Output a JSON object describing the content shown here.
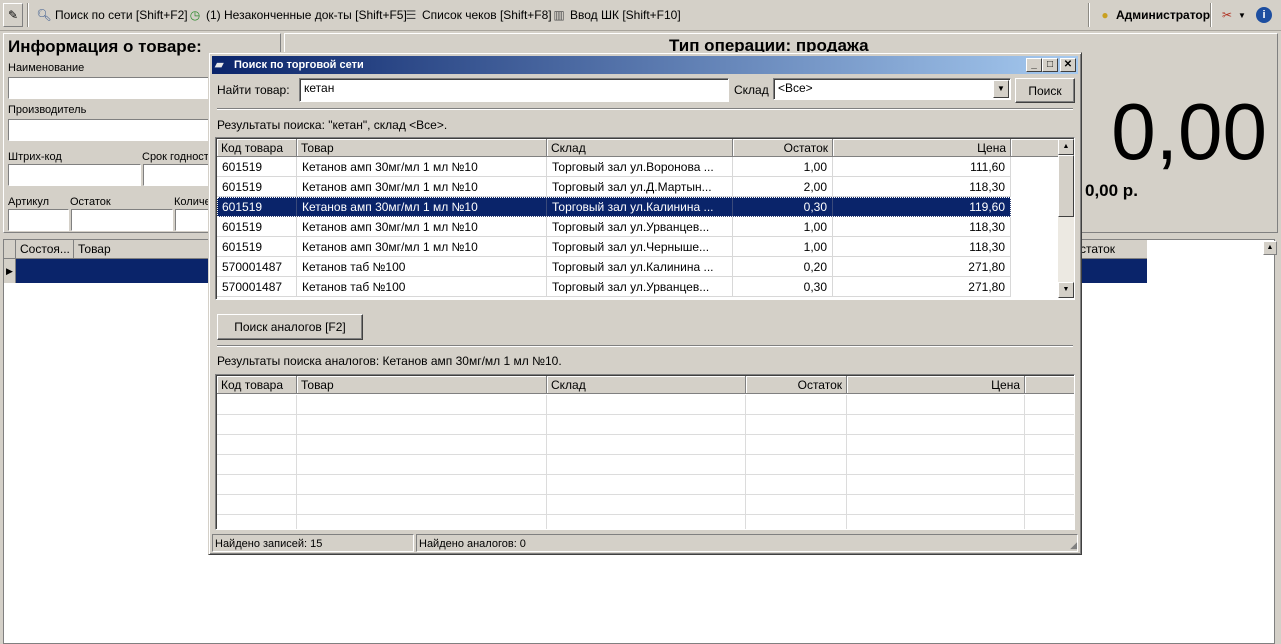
{
  "toolbar": {
    "items": [
      {
        "label": "Поиск по сети [Shift+F2]",
        "icon": "magnifier-icon"
      },
      {
        "label": "(1) Незаконченные док-ты [Shift+F5]",
        "icon": "clock-icon"
      },
      {
        "label": "Список чеков [Shift+F8]",
        "icon": "list-icon"
      },
      {
        "label": "Ввод ШК [Shift+F10]",
        "icon": "barcode-icon"
      }
    ],
    "user": "Администратор"
  },
  "product_info": {
    "heading": "Информация о товаре:",
    "name_label": "Наименование",
    "manufacturer_label": "Производитель",
    "barcode_label": "Штрих-код",
    "expiry_label": "Срок годност",
    "article_label": "Артикул",
    "stock_label": "Остаток",
    "qty_label": "Количе"
  },
  "operation": {
    "heading": "Тип операции: продажа",
    "total": "0,00",
    "sum": "0,00 р."
  },
  "main_grid": {
    "columns": [
      "Состоя...",
      "Товар"
    ],
    "right_column": "статок"
  },
  "dialog": {
    "title": "Поиск по торговой сети",
    "find_label": "Найти товар:",
    "find_value": "кетан",
    "warehouse_label": "Склад",
    "warehouse_value": "<Все>",
    "search_button": "Поиск",
    "results_caption": "Результаты поиска: \"кетан\", склад <Все>.",
    "columns": [
      "Код товара",
      "Товар",
      "Склад",
      "Остаток",
      "Цена"
    ],
    "rows": [
      {
        "code": "601519",
        "product": "Кетанов амп  30мг/мл 1 мл №10",
        "warehouse": "Торговый зал ул.Воронова ...",
        "stock": "1,00",
        "price": "111,60"
      },
      {
        "code": "601519",
        "product": "Кетанов амп  30мг/мл 1 мл №10",
        "warehouse": "Торговый зал ул.Д.Мартын...",
        "stock": "2,00",
        "price": "118,30"
      },
      {
        "code": "601519",
        "product": "Кетанов амп  30мг/мл 1 мл №10",
        "warehouse": "Торговый зал ул.Калинина ...",
        "stock": "0,30",
        "price": "119,60"
      },
      {
        "code": "601519",
        "product": "Кетанов амп  30мг/мл 1 мл №10",
        "warehouse": "Торговый зал ул.Урванцев...",
        "stock": "1,00",
        "price": "118,30"
      },
      {
        "code": "601519",
        "product": "Кетанов амп  30мг/мл 1 мл №10",
        "warehouse": "Торговый зал ул.Черныше...",
        "stock": "1,00",
        "price": "118,30"
      },
      {
        "code": "570001487",
        "product": "Кетанов таб №100",
        "warehouse": "Торговый зал ул.Калинина ...",
        "stock": "0,20",
        "price": "271,80"
      },
      {
        "code": "570001487",
        "product": "Кетанов таб №100",
        "warehouse": "Торговый зал ул.Урванцев...",
        "stock": "0,30",
        "price": "271,80"
      }
    ],
    "analog_button": "Поиск аналогов [F2]",
    "analog_caption": "Результаты поиска аналогов: Кетанов амп  30мг/мл 1 мл №10.",
    "analog_columns": [
      "Код товара",
      "Товар",
      "Склад",
      "Остаток",
      "Цена"
    ],
    "status_found": "Найдено записей: 15",
    "status_analogs": "Найдено аналогов: 0"
  }
}
